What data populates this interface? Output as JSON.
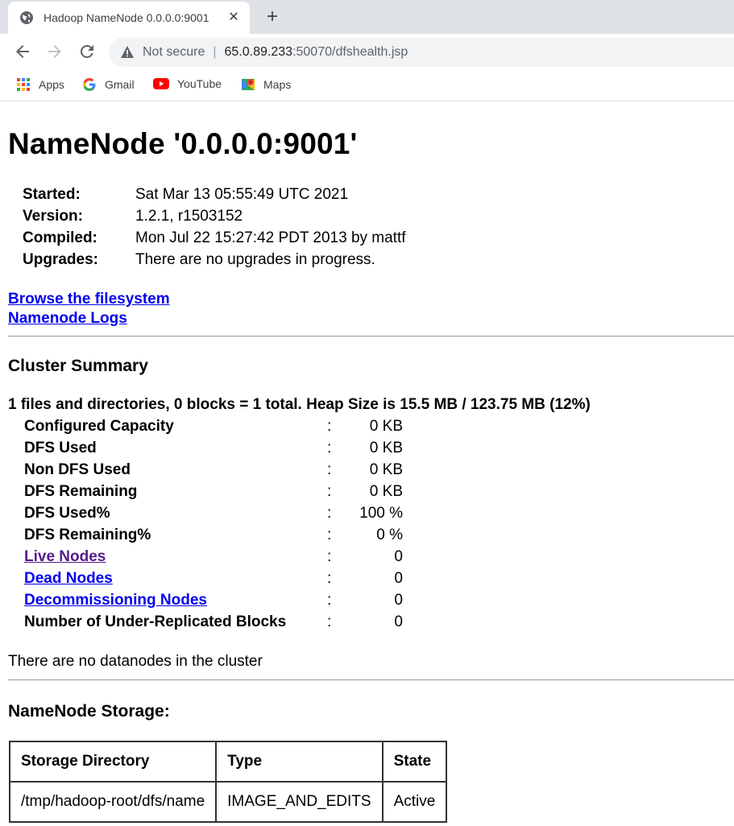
{
  "browser": {
    "tab_title": "Hadoop NameNode 0.0.0.0:9001",
    "tab_close": "✕",
    "new_tab": "+",
    "security_label": "Not secure",
    "separator": "|",
    "url_host": "65.0.89.233",
    "url_rest": ":50070/dfshealth.jsp",
    "bookmarks": [
      {
        "label": "Apps",
        "icon": "apps-grid-icon"
      },
      {
        "label": "Gmail",
        "icon": "google-icon"
      },
      {
        "label": "YouTube",
        "icon": "youtube-icon"
      },
      {
        "label": "Maps",
        "icon": "maps-icon"
      }
    ]
  },
  "page": {
    "title": "NameNode '0.0.0.0:9001'",
    "info": [
      {
        "key": "Started:",
        "value": "Sat Mar 13 05:55:49 UTC 2021"
      },
      {
        "key": "Version:",
        "value": "1.2.1, r1503152"
      },
      {
        "key": "Compiled:",
        "value": "Mon Jul 22 15:27:42 PDT 2013 by mattf"
      },
      {
        "key": "Upgrades:",
        "value": "There are no upgrades in progress."
      }
    ],
    "links": {
      "browse": "Browse the filesystem",
      "logs": "Namenode Logs"
    },
    "cluster_summary_heading": "Cluster Summary",
    "summary_line": "1 files and directories, 0 blocks = 1 total. Heap Size is 15.5 MB / 123.75 MB (12%)",
    "summary_rows": [
      {
        "key": "Configured Capacity",
        "colon": ":",
        "value": "0 KB"
      },
      {
        "key": "DFS Used",
        "colon": ":",
        "value": "0 KB"
      },
      {
        "key": "Non DFS Used",
        "colon": ":",
        "value": "0 KB"
      },
      {
        "key": "DFS Remaining",
        "colon": ":",
        "value": "0 KB"
      },
      {
        "key": "DFS Used%",
        "colon": ":",
        "value": "100 %"
      },
      {
        "key": "DFS Remaining%",
        "colon": ":",
        "value": "0 %"
      },
      {
        "key": "Live Nodes",
        "colon": ":",
        "value": "0"
      },
      {
        "key": "Dead Nodes",
        "colon": ":",
        "value": "0"
      },
      {
        "key": "Decommissioning Nodes",
        "colon": ":",
        "value": "0"
      },
      {
        "key": "Number of Under-Replicated Blocks",
        "colon": ":",
        "value": "0"
      }
    ],
    "no_datanodes": "There are no datanodes in the cluster",
    "storage_heading": "NameNode Storage:",
    "storage_table": {
      "headers": [
        "Storage Directory",
        "Type",
        "State"
      ],
      "rows": [
        [
          "/tmp/hadoop-root/dfs/name",
          "IMAGE_AND_EDITS",
          "Active"
        ]
      ]
    }
  },
  "colors": {
    "link": "#0000ee",
    "visited_link": "#551a8b",
    "tabstrip": "#dee1e6",
    "omnibox": "#f1f3f4"
  }
}
